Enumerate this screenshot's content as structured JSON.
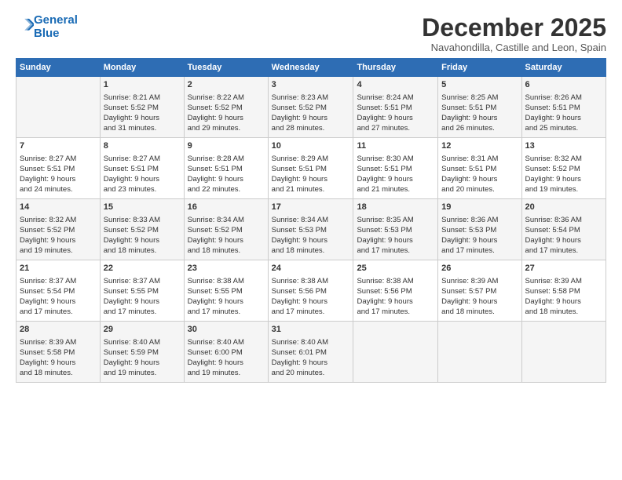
{
  "header": {
    "logo_line1": "General",
    "logo_line2": "Blue",
    "month": "December 2025",
    "location": "Navahondilla, Castille and Leon, Spain"
  },
  "days_of_week": [
    "Sunday",
    "Monday",
    "Tuesday",
    "Wednesday",
    "Thursday",
    "Friday",
    "Saturday"
  ],
  "weeks": [
    [
      {
        "day": "",
        "info": ""
      },
      {
        "day": "1",
        "info": "Sunrise: 8:21 AM\nSunset: 5:52 PM\nDaylight: 9 hours\nand 31 minutes."
      },
      {
        "day": "2",
        "info": "Sunrise: 8:22 AM\nSunset: 5:52 PM\nDaylight: 9 hours\nand 29 minutes."
      },
      {
        "day": "3",
        "info": "Sunrise: 8:23 AM\nSunset: 5:52 PM\nDaylight: 9 hours\nand 28 minutes."
      },
      {
        "day": "4",
        "info": "Sunrise: 8:24 AM\nSunset: 5:51 PM\nDaylight: 9 hours\nand 27 minutes."
      },
      {
        "day": "5",
        "info": "Sunrise: 8:25 AM\nSunset: 5:51 PM\nDaylight: 9 hours\nand 26 minutes."
      },
      {
        "day": "6",
        "info": "Sunrise: 8:26 AM\nSunset: 5:51 PM\nDaylight: 9 hours\nand 25 minutes."
      }
    ],
    [
      {
        "day": "7",
        "info": "Sunrise: 8:27 AM\nSunset: 5:51 PM\nDaylight: 9 hours\nand 24 minutes."
      },
      {
        "day": "8",
        "info": "Sunrise: 8:27 AM\nSunset: 5:51 PM\nDaylight: 9 hours\nand 23 minutes."
      },
      {
        "day": "9",
        "info": "Sunrise: 8:28 AM\nSunset: 5:51 PM\nDaylight: 9 hours\nand 22 minutes."
      },
      {
        "day": "10",
        "info": "Sunrise: 8:29 AM\nSunset: 5:51 PM\nDaylight: 9 hours\nand 21 minutes."
      },
      {
        "day": "11",
        "info": "Sunrise: 8:30 AM\nSunset: 5:51 PM\nDaylight: 9 hours\nand 21 minutes."
      },
      {
        "day": "12",
        "info": "Sunrise: 8:31 AM\nSunset: 5:51 PM\nDaylight: 9 hours\nand 20 minutes."
      },
      {
        "day": "13",
        "info": "Sunrise: 8:32 AM\nSunset: 5:52 PM\nDaylight: 9 hours\nand 19 minutes."
      }
    ],
    [
      {
        "day": "14",
        "info": "Sunrise: 8:32 AM\nSunset: 5:52 PM\nDaylight: 9 hours\nand 19 minutes."
      },
      {
        "day": "15",
        "info": "Sunrise: 8:33 AM\nSunset: 5:52 PM\nDaylight: 9 hours\nand 18 minutes."
      },
      {
        "day": "16",
        "info": "Sunrise: 8:34 AM\nSunset: 5:52 PM\nDaylight: 9 hours\nand 18 minutes."
      },
      {
        "day": "17",
        "info": "Sunrise: 8:34 AM\nSunset: 5:53 PM\nDaylight: 9 hours\nand 18 minutes."
      },
      {
        "day": "18",
        "info": "Sunrise: 8:35 AM\nSunset: 5:53 PM\nDaylight: 9 hours\nand 17 minutes."
      },
      {
        "day": "19",
        "info": "Sunrise: 8:36 AM\nSunset: 5:53 PM\nDaylight: 9 hours\nand 17 minutes."
      },
      {
        "day": "20",
        "info": "Sunrise: 8:36 AM\nSunset: 5:54 PM\nDaylight: 9 hours\nand 17 minutes."
      }
    ],
    [
      {
        "day": "21",
        "info": "Sunrise: 8:37 AM\nSunset: 5:54 PM\nDaylight: 9 hours\nand 17 minutes."
      },
      {
        "day": "22",
        "info": "Sunrise: 8:37 AM\nSunset: 5:55 PM\nDaylight: 9 hours\nand 17 minutes."
      },
      {
        "day": "23",
        "info": "Sunrise: 8:38 AM\nSunset: 5:55 PM\nDaylight: 9 hours\nand 17 minutes."
      },
      {
        "day": "24",
        "info": "Sunrise: 8:38 AM\nSunset: 5:56 PM\nDaylight: 9 hours\nand 17 minutes."
      },
      {
        "day": "25",
        "info": "Sunrise: 8:38 AM\nSunset: 5:56 PM\nDaylight: 9 hours\nand 17 minutes."
      },
      {
        "day": "26",
        "info": "Sunrise: 8:39 AM\nSunset: 5:57 PM\nDaylight: 9 hours\nand 18 minutes."
      },
      {
        "day": "27",
        "info": "Sunrise: 8:39 AM\nSunset: 5:58 PM\nDaylight: 9 hours\nand 18 minutes."
      }
    ],
    [
      {
        "day": "28",
        "info": "Sunrise: 8:39 AM\nSunset: 5:58 PM\nDaylight: 9 hours\nand 18 minutes."
      },
      {
        "day": "29",
        "info": "Sunrise: 8:40 AM\nSunset: 5:59 PM\nDaylight: 9 hours\nand 19 minutes."
      },
      {
        "day": "30",
        "info": "Sunrise: 8:40 AM\nSunset: 6:00 PM\nDaylight: 9 hours\nand 19 minutes."
      },
      {
        "day": "31",
        "info": "Sunrise: 8:40 AM\nSunset: 6:01 PM\nDaylight: 9 hours\nand 20 minutes."
      },
      {
        "day": "",
        "info": ""
      },
      {
        "day": "",
        "info": ""
      },
      {
        "day": "",
        "info": ""
      }
    ]
  ]
}
